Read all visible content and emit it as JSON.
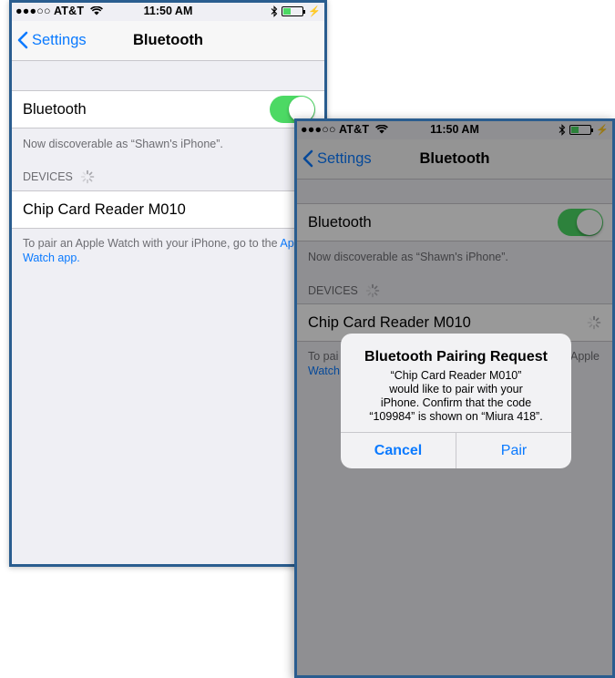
{
  "status": {
    "carrier": "●●●○○ AT&T",
    "time": "11:50 AM",
    "icons": [
      "wifi-icon",
      "bluetooth-icon",
      "battery-charging-icon"
    ]
  },
  "nav": {
    "back_label": "Settings",
    "title": "Bluetooth"
  },
  "settings": {
    "bluetooth_label": "Bluetooth",
    "bluetooth_on": true,
    "discoverable_text": "Now discoverable as “Shawn's iPhone”.",
    "devices_header": "DEVICES",
    "device_name": "Chip Card Reader M010",
    "watch_hint": "To pair an Apple Watch with your iPhone, go to the ",
    "watch_link": "Apple Watch app",
    "watch_period": "."
  },
  "back_screen": {
    "watch_hint_left": "To pai",
    "watch_hint_left_2": "Watch",
    "watch_link_right": "Apple"
  },
  "alert": {
    "title": "Bluetooth Pairing Request",
    "message_lines": [
      "“Chip Card Reader M010”",
      "would like to pair with your",
      "iPhone. Confirm that the code",
      "“109984” is shown on “Miura 418”."
    ],
    "cancel_label": "Cancel",
    "pair_label": "Pair"
  },
  "colors": {
    "accent": "#0a7aff",
    "toggle_on": "#4cd964",
    "frame_border": "#2a5d8f",
    "background": "#efeff4"
  }
}
